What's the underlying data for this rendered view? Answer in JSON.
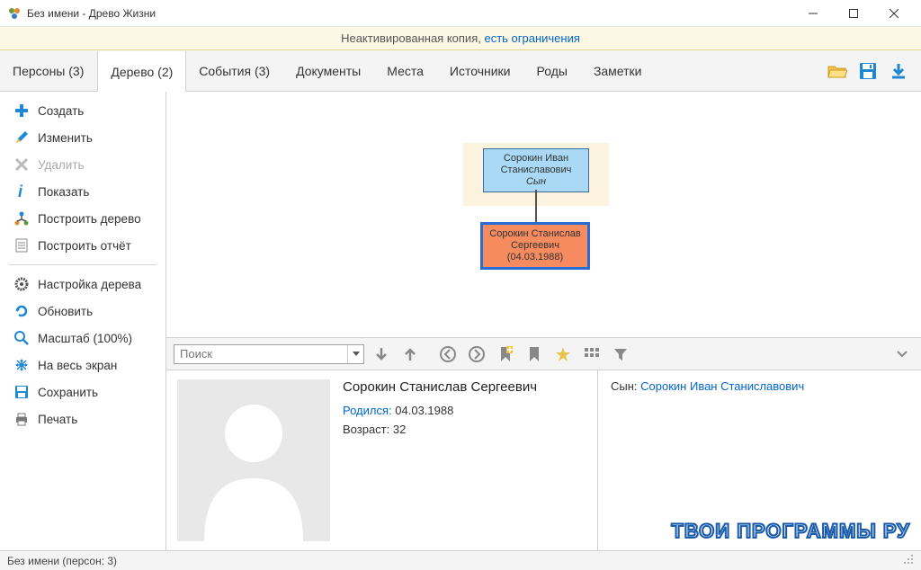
{
  "window": {
    "title": "Без имени - Древо Жизни"
  },
  "notice": {
    "text": "Неактивированная копия, ",
    "link": "есть ограничения"
  },
  "tabs": [
    {
      "label": "Персоны (3)"
    },
    {
      "label": "Дерево (2)",
      "active": true
    },
    {
      "label": "События (3)"
    },
    {
      "label": "Документы"
    },
    {
      "label": "Места"
    },
    {
      "label": "Источники"
    },
    {
      "label": "Роды"
    },
    {
      "label": "Заметки"
    }
  ],
  "sidebar": {
    "group1": [
      {
        "label": "Создать",
        "icon": "plus",
        "color": "#1e88d2"
      },
      {
        "label": "Изменить",
        "icon": "pencil",
        "color": "#1e88d2"
      },
      {
        "label": "Удалить",
        "icon": "x",
        "color": "#aaa",
        "disabled": true
      },
      {
        "label": "Показать",
        "icon": "info",
        "color": "#1e88d2"
      },
      {
        "label": "Построить дерево",
        "icon": "tree",
        "color": "#1e88d2"
      },
      {
        "label": "Построить отчёт",
        "icon": "doc",
        "color": "#777"
      }
    ],
    "group2": [
      {
        "label": "Настройка дерева",
        "icon": "gear",
        "color": "#555"
      },
      {
        "label": "Обновить",
        "icon": "refresh",
        "color": "#1e88d2"
      },
      {
        "label": "Масштаб (100%)",
        "icon": "zoom",
        "color": "#1e88d2"
      },
      {
        "label": "На весь экран",
        "icon": "expand",
        "color": "#1e88d2"
      },
      {
        "label": "Сохранить",
        "icon": "save",
        "color": "#1e88d2"
      },
      {
        "label": "Печать",
        "icon": "print",
        "color": "#555"
      }
    ]
  },
  "tree": {
    "parent": {
      "name1": "Сорокин Иван",
      "name2": "Станиславович",
      "relation": "Сын"
    },
    "selected": {
      "name1": "Сорокин Станислав",
      "name2": "Сергеевич",
      "date": "(04.03.1988)"
    }
  },
  "search": {
    "placeholder": "Поиск"
  },
  "details": {
    "name": "Сорокин Станислав Сергеевич",
    "born_label": "Родился:",
    "born_value": "04.03.1988",
    "age_label": "Возраст:",
    "age_value": "32",
    "relation_label": "Сын:",
    "relation_link": "Сорокин Иван Станиславович"
  },
  "status": {
    "text": "Без имени (персон: 3)"
  },
  "watermark": "ТВОИ ПРОГРАММЫ РУ"
}
